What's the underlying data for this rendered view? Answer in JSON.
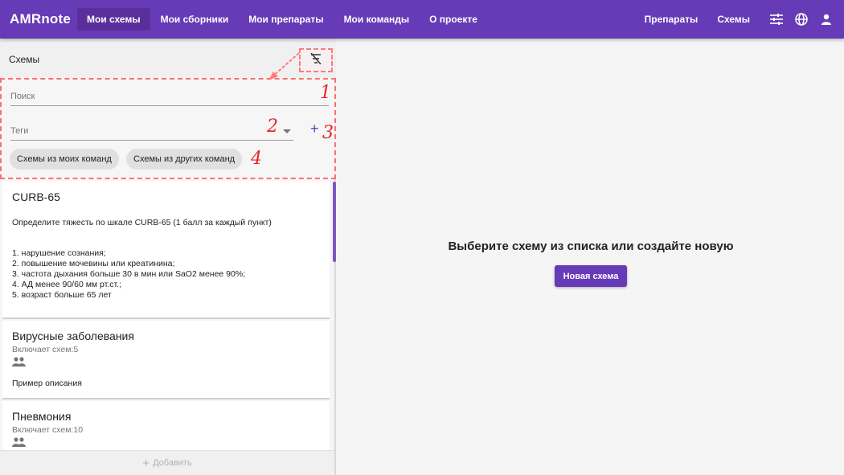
{
  "app": {
    "brand": "AMRnote"
  },
  "nav": {
    "items": [
      {
        "label": "Мои схемы",
        "active": true
      },
      {
        "label": "Мои сборники",
        "active": false
      },
      {
        "label": "Мои препараты",
        "active": false
      },
      {
        "label": "Мои команды",
        "active": false
      },
      {
        "label": "О проекте",
        "active": false
      }
    ],
    "right": {
      "drugs": "Препараты",
      "schemes": "Схемы"
    },
    "icons": [
      "tune-icon",
      "globe-icon",
      "account-icon"
    ]
  },
  "panel": {
    "title": "Схемы",
    "filter_icon": "filter-off-icon",
    "search_placeholder": "Поиск",
    "tags_placeholder": "Теги",
    "add_tag": "+",
    "chips": [
      "Схемы из моих команд",
      "Схемы из других команд"
    ],
    "annotations": [
      "1",
      "2",
      "3",
      "4"
    ]
  },
  "cards": [
    {
      "title": "CURB-65",
      "description": "Определите тяжесть по шкале CURB-65 (1 балл за каждый пункт)",
      "lines": [
        "1. нарушение сознания;",
        "2. повышение мочевины или креатинина;",
        "3. частота дыхания больше 30 в мин или SaO2 менее 90%;",
        "4. АД менее 90/60 мм рт.ст.;",
        "5. возраст больше 65 лет"
      ]
    },
    {
      "title": "Вирусные заболевания",
      "subtitle": "Включает схем:5",
      "icon": "group-icon",
      "description": "Пример описания"
    },
    {
      "title": "Пневмония",
      "subtitle": "Включает схем:10",
      "icon": "group-icon"
    }
  ],
  "add_button": {
    "plus": "+",
    "label": "Добавить"
  },
  "main": {
    "title": "Выберите схему из списка или создайте новую",
    "new_button": "Новая схема"
  },
  "colors": {
    "primary": "#673ab7",
    "annotation": "#e8242a"
  }
}
